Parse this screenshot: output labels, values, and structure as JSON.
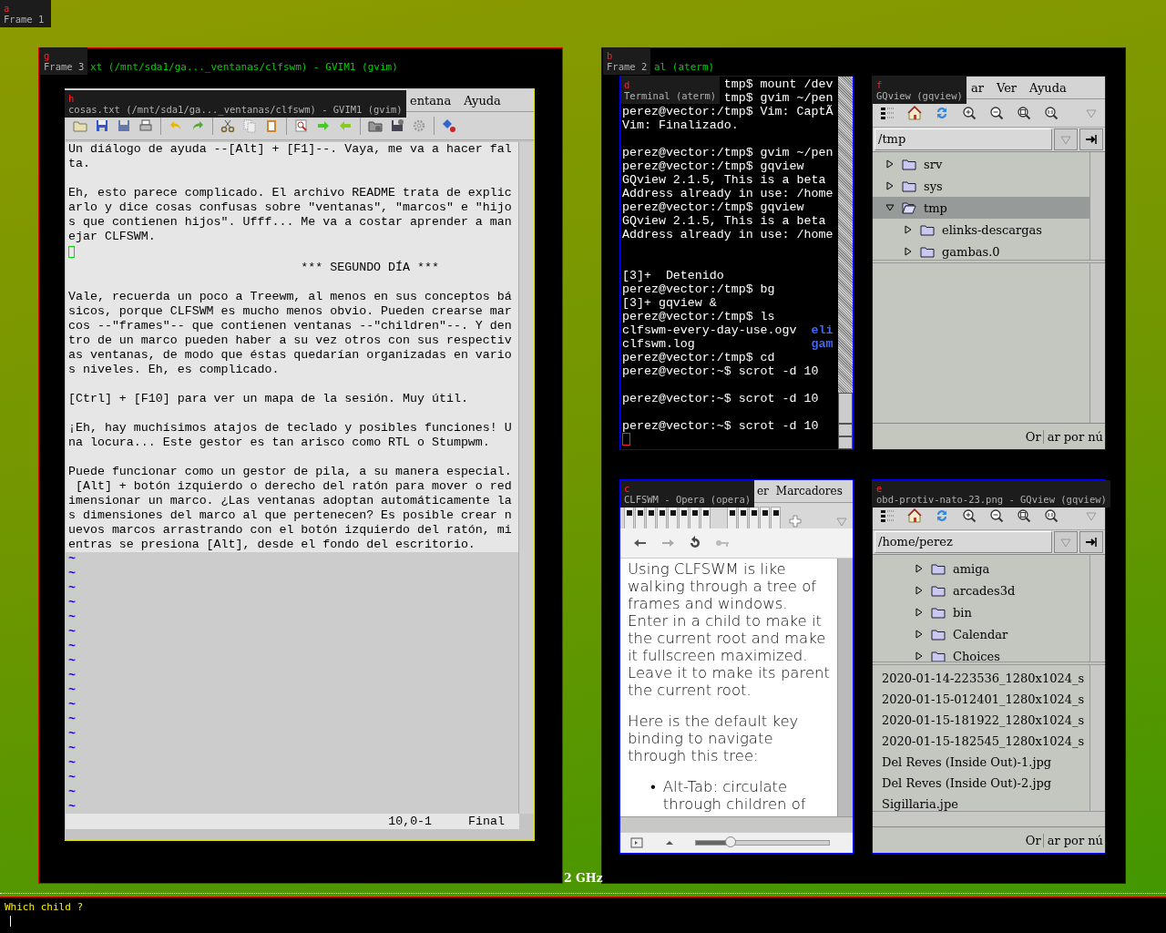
{
  "frame_1": {
    "key": "a",
    "label": "Frame 1"
  },
  "frame_3": {
    "key": "g",
    "label": "Frame 3",
    "title": "xt (/mnt/sda1/ga..._ventanas/clfswm) - GVIM1 (gvim)",
    "gvim": {
      "key": "h",
      "title": "cosas.txt (/mnt/sda1/ga..._ventanas/clfswm) - GVIM1 (gvim)",
      "menu": [
        "entana",
        "Ayuda"
      ],
      "lines": [
        {
          "kind": "text",
          "text": "Un diálogo de ayuda --[Alt] + [F1]--. Vaya, me va a hacer fal"
        },
        {
          "kind": "text",
          "text": "ta."
        },
        {
          "kind": "blank"
        },
        {
          "kind": "text",
          "text": "Eh, esto parece complicado. El archivo README trata de explic"
        },
        {
          "kind": "text",
          "text": "arlo y dice cosas confusas sobre \"ventanas\", \"marcos\" e \"hijo"
        },
        {
          "kind": "text",
          "text": "s que contienen hijos\". Ufff... Me va a costar aprender a man"
        },
        {
          "kind": "text",
          "text": "ejar CLFSWM."
        },
        {
          "kind": "cursor"
        },
        {
          "kind": "center",
          "text": "*** SEGUNDO DÍA ***"
        },
        {
          "kind": "blank"
        },
        {
          "kind": "text",
          "text": "Vale, recuerda un poco a Treewm, al menos en sus conceptos bá"
        },
        {
          "kind": "text",
          "text": "sicos, porque CLFSWM es mucho menos obvio. Pueden crearse mar"
        },
        {
          "kind": "text",
          "text": "cos --\"frames\"-- que contienen ventanas --\"children\"--. Y den"
        },
        {
          "kind": "text",
          "text": "tro de un marco pueden haber a su vez otros con sus respectiv"
        },
        {
          "kind": "text",
          "text": "as ventanas, de modo que éstas quedarían organizadas en vario"
        },
        {
          "kind": "text",
          "text": "s niveles. Eh, es complicado."
        },
        {
          "kind": "blank"
        },
        {
          "kind": "text",
          "text": "[Ctrl] + [F10] para ver un mapa de la sesión. Muy útil."
        },
        {
          "kind": "blank"
        },
        {
          "kind": "text",
          "text": "¡Eh, hay muchísimos atajos de teclado y posibles funciones! U"
        },
        {
          "kind": "text",
          "text": "na locura... Este gestor es tan arisco como RTL o Stumpwm."
        },
        {
          "kind": "blank"
        },
        {
          "kind": "text",
          "text": "Puede funcionar como un gestor de pila, a su manera especial."
        },
        {
          "kind": "text",
          "text": " [Alt] + botón izquierdo o derecho del ratón para mover o red"
        },
        {
          "kind": "text",
          "text": "imensionar un marco. ¿Las ventanas adoptan automáticamente la"
        },
        {
          "kind": "text",
          "text": "s dimensiones del marco al que pertenecen? Es posible crear n"
        },
        {
          "kind": "text",
          "text": "uevos marcos arrastrando con el botón izquierdo del ratón, mi"
        },
        {
          "kind": "text",
          "text": "entras se presiona [Alt], desde el fondo del escritorio."
        }
      ],
      "filler": [
        "~",
        "~",
        "~",
        "~",
        "~",
        "~",
        "~",
        "~",
        "~",
        "~",
        "~",
        "~",
        "~",
        "~",
        "~",
        "~",
        "~",
        "~"
      ],
      "position": "10,0-1",
      "scroll": "Final"
    }
  },
  "frame_2": {
    "key": "b",
    "label": "Frame 2",
    "title": "al (aterm)",
    "terminal": {
      "key": "d",
      "title": "Terminal (aterm)",
      "lines": [
        {
          "kind": "partial",
          "text": "tmp$ mount /dev"
        },
        {
          "kind": "partial",
          "text": "tmp$ gvim ~/pen"
        },
        {
          "kind": "text",
          "text": "perez@vector:/tmp$ Vim: CaptÃ"
        },
        {
          "kind": "text",
          "text": "Vim: Finalizado."
        },
        {
          "kind": "blank"
        },
        {
          "kind": "text",
          "text": "perez@vector:/tmp$ gvim ~/pen"
        },
        {
          "kind": "text",
          "text": "perez@vector:/tmp$ gqview"
        },
        {
          "kind": "text",
          "text": "GQview 2.1.5, This is a beta"
        },
        {
          "kind": "text",
          "text": "Address already in use: /home"
        },
        {
          "kind": "text",
          "text": "perez@vector:/tmp$ gqview"
        },
        {
          "kind": "text",
          "text": "GQview 2.1.5, This is a beta"
        },
        {
          "kind": "text",
          "text": "Address already in use: /home"
        },
        {
          "kind": "blank"
        },
        {
          "kind": "blank"
        },
        {
          "kind": "text",
          "text": "[3]+  Detenido"
        },
        {
          "kind": "text",
          "text": "perez@vector:/tmp$ bg"
        },
        {
          "kind": "text",
          "text": "[3]+ gqview &"
        },
        {
          "kind": "text",
          "text": "perez@vector:/tmp$ ls"
        },
        {
          "kind": "text",
          "text": "clfswm-every-day-use.ogv",
          "extra": "eli"
        },
        {
          "kind": "text",
          "text": "clfswm.log",
          "extra": "gam"
        },
        {
          "kind": "text",
          "text": "perez@vector:/tmp$ cd"
        },
        {
          "kind": "text",
          "text": "perez@vector:~$ scrot -d 10"
        },
        {
          "kind": "blank"
        },
        {
          "kind": "text",
          "text": "perez@vector:~$ scrot -d 10"
        },
        {
          "kind": "blank"
        },
        {
          "kind": "text",
          "text": "perez@vector:~$ scrot -d 10"
        },
        {
          "kind": "cursor"
        }
      ]
    },
    "gqview_top": {
      "key": "f",
      "title": "GQview (gqview)",
      "menu": [
        "ar",
        "Ver",
        "Ayuda"
      ],
      "path": "/tmp",
      "tree": [
        {
          "label": "srv",
          "expanded": false,
          "selected": false
        },
        {
          "label": "sys",
          "expanded": false,
          "selected": false
        },
        {
          "label": "tmp",
          "expanded": true,
          "selected": true,
          "children": [
            {
              "label": "elinks-descargas",
              "expanded": false,
              "selected": false
            },
            {
              "label": "gambas.0",
              "expanded": false,
              "selected": false
            }
          ]
        }
      ],
      "status": [
        "Or",
        "ar por nú"
      ]
    },
    "opera": {
      "key": "c",
      "title": "CLFSWM - Opera (opera)",
      "menu": [
        "er",
        "Marcadores"
      ],
      "paragraphs": [
        "Using CLFSWM is like walking through a tree of frames and windows. Enter in a child to make it the current root and make it fullscreen maximized. Leave it to make its parent the current root.",
        "Here is the default key binding to navigate through this tree:"
      ],
      "bullets": [
        {
          "marker": "•",
          "text": "Alt-Tab: circulate through children of"
        }
      ]
    },
    "gqview_bottom": {
      "key": "e",
      "title": "obd-protiv-nato-23.png - GQview (gqview)",
      "path": "/home/perez",
      "tree": [
        {
          "label": "amiga",
          "expanded": false,
          "selected": false
        },
        {
          "label": "arcades3d",
          "expanded": false,
          "selected": false
        },
        {
          "label": "bin",
          "expanded": false,
          "selected": false
        },
        {
          "label": "Calendar",
          "expanded": false,
          "selected": false
        },
        {
          "label": "Choices",
          "expanded": false,
          "selected": false
        }
      ],
      "files": [
        "2020-01-14-223536_1280x1024_s",
        "2020-01-15-012401_1280x1024_s",
        "2020-01-15-181922_1280x1024_s",
        "2020-01-15-182545_1280x1024_s",
        "Del Reves (Inside Out)-1.jpg",
        "Del Reves (Inside Out)-2.jpg",
        "Sigillaria.jpe"
      ],
      "status": [
        "Or",
        "ar por nú"
      ]
    }
  },
  "cpu_label": "2 GHz",
  "prompt": "Which child ?"
}
